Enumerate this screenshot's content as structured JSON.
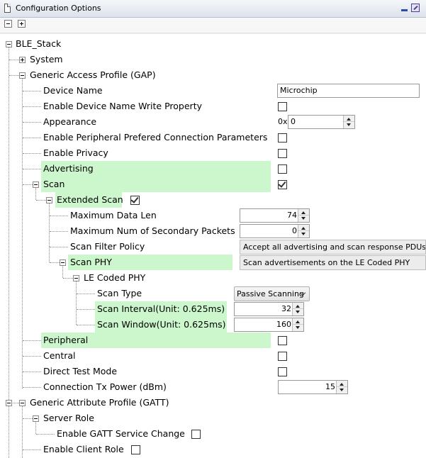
{
  "window": {
    "title": "Configuration Options",
    "document_icon": "document-icon",
    "minimize_icon": "minimize-icon",
    "restore_icon": "restore-icon"
  },
  "toolbar": {
    "collapse_all_icon": "minus-box-icon",
    "expand_all_icon": "plus-box-icon"
  },
  "tree": {
    "root": "BLE_Stack",
    "system": "System",
    "gap": {
      "label": "Generic Access Profile (GAP)",
      "device_name": {
        "label": "Device Name",
        "value": "Microchip"
      },
      "enable_device_name_write": {
        "label": "Enable Device Name Write Property",
        "checked": false
      },
      "appearance": {
        "label": "Appearance",
        "prefix": "0x",
        "value": "0"
      },
      "enable_peripheral_pref_conn": {
        "label": "Enable Peripheral Prefered Connection Parameters",
        "checked": false
      },
      "enable_privacy": {
        "label": "Enable Privacy",
        "checked": false
      },
      "advertising": {
        "label": "Advertising",
        "checked": false
      },
      "scan": {
        "label": "Scan",
        "checked": true,
        "extended_scan": {
          "label": "Extended Scan",
          "checked": true,
          "max_data_len": {
            "label": "Maximum Data Len",
            "value": "74"
          },
          "max_secondary_packets": {
            "label": "Maximum Num of Secondary Packets",
            "value": "0"
          },
          "scan_filter_policy": {
            "label": "Scan Filter Policy",
            "value": "Accept all advertising and scan response PDUs except directed advertising PDUs not addressed to this device"
          },
          "scan_phy": {
            "label": "Scan PHY",
            "value": "Scan advertisements on the LE Coded PHY",
            "le_coded_phy": {
              "label": "LE Coded PHY",
              "scan_type": {
                "label": "Scan Type",
                "value": "Passive Scanning"
              },
              "scan_interval": {
                "label": "Scan Interval(Unit: 0.625ms)",
                "value": "32"
              },
              "scan_window": {
                "label": "Scan Window(Unit: 0.625ms)",
                "value": "160"
              }
            }
          }
        }
      },
      "peripheral": {
        "label": "Peripheral",
        "checked": false
      },
      "central": {
        "label": "Central",
        "checked": false
      },
      "direct_test_mode": {
        "label": "Direct Test Mode",
        "checked": false
      },
      "conn_tx_power": {
        "label": "Connection Tx Power (dBm)",
        "value": "15"
      }
    },
    "gatt": {
      "label": "Generic Attribute Profile (GATT)",
      "server_role": {
        "label": "Server Role",
        "enable_gatt_service_change": {
          "label": "Enable GATT Service Change",
          "checked": false
        }
      },
      "enable_client_role": {
        "label": "Enable Client Role",
        "checked": false
      }
    }
  },
  "colors": {
    "highlight": "#ccf7cc",
    "title_bar": "#dde3ec"
  }
}
